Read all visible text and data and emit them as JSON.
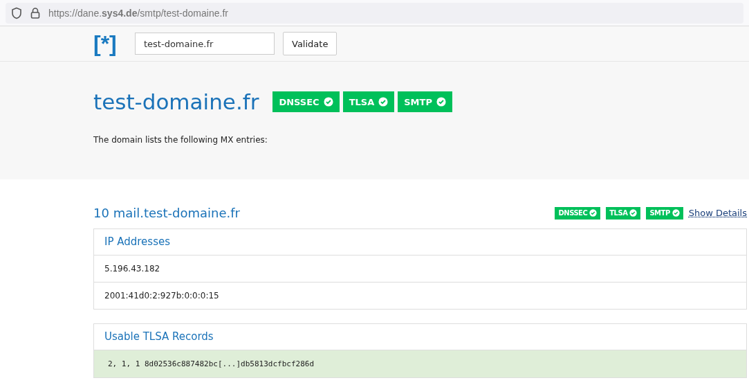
{
  "browser": {
    "url": "https://dane.**sys4.de**/smtp/test-domaine.fr"
  },
  "header": {
    "logo": "[*]",
    "search": {
      "value": "test-domaine.fr"
    },
    "button": "Validate"
  },
  "domain": {
    "title": "test-domaine.fr",
    "badges": [
      {
        "label": "DNSSEC",
        "passed": true
      },
      {
        "label": "TLSA",
        "passed": true
      },
      {
        "label": "SMTP",
        "passed": true
      }
    ],
    "description": "The domain lists the following MX entries:"
  },
  "mx_entries": [
    {
      "title": "10 mail.test-domaine.fr",
      "badges": [
        {
          "label": "DNSSEC",
          "passed": true
        },
        {
          "label": "TLSA",
          "passed": true
        },
        {
          "label": "SMTP",
          "passed": true
        }
      ],
      "details_link": "Show Details",
      "panels": [
        {
          "title": "IP Addresses",
          "kind": "plain",
          "rows": [
            "5.196.43.182",
            "2001:41d0:2:927b:0:0:0:15"
          ]
        },
        {
          "title": "Usable TLSA Records",
          "kind": "record",
          "rows": [
            "2, 1, 1 8d02536c887482bc[...]db5813dcfbcf286d"
          ]
        }
      ]
    }
  ]
}
